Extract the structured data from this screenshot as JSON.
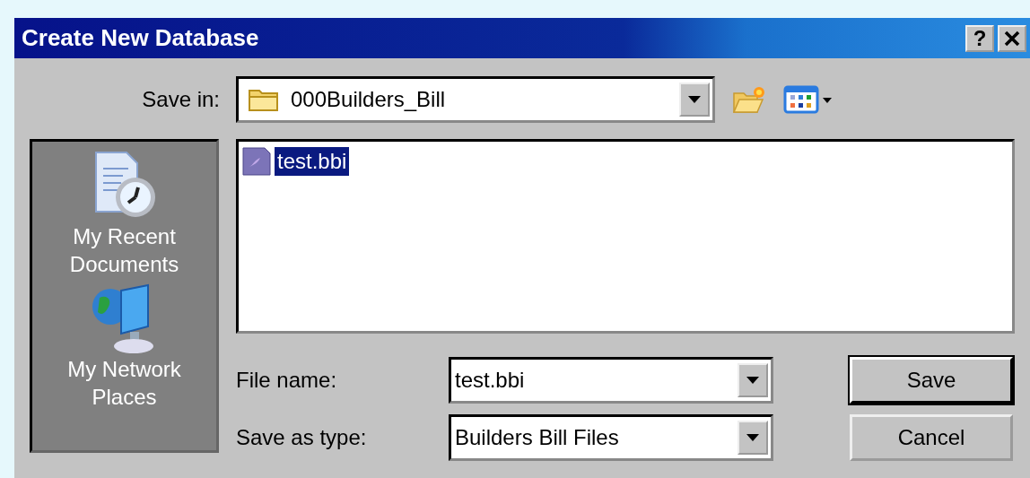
{
  "window": {
    "title": "Create New Database",
    "help": "?"
  },
  "save_in": {
    "label": "Save in:",
    "value": "000Builders_Bill"
  },
  "places": [
    {
      "label": "My Recent Documents",
      "kind": "recent"
    },
    {
      "label": "My Network Places",
      "kind": "network"
    }
  ],
  "files": [
    {
      "name": "test.bbi",
      "selected": true
    }
  ],
  "file_name": {
    "label": "File name:",
    "value": "test.bbi"
  },
  "save_as_type": {
    "label": "Save as type:",
    "value": "Builders Bill Files"
  },
  "buttons": [
    {
      "label": "Save",
      "default": true
    },
    {
      "label": "Cancel",
      "default": false
    }
  ]
}
